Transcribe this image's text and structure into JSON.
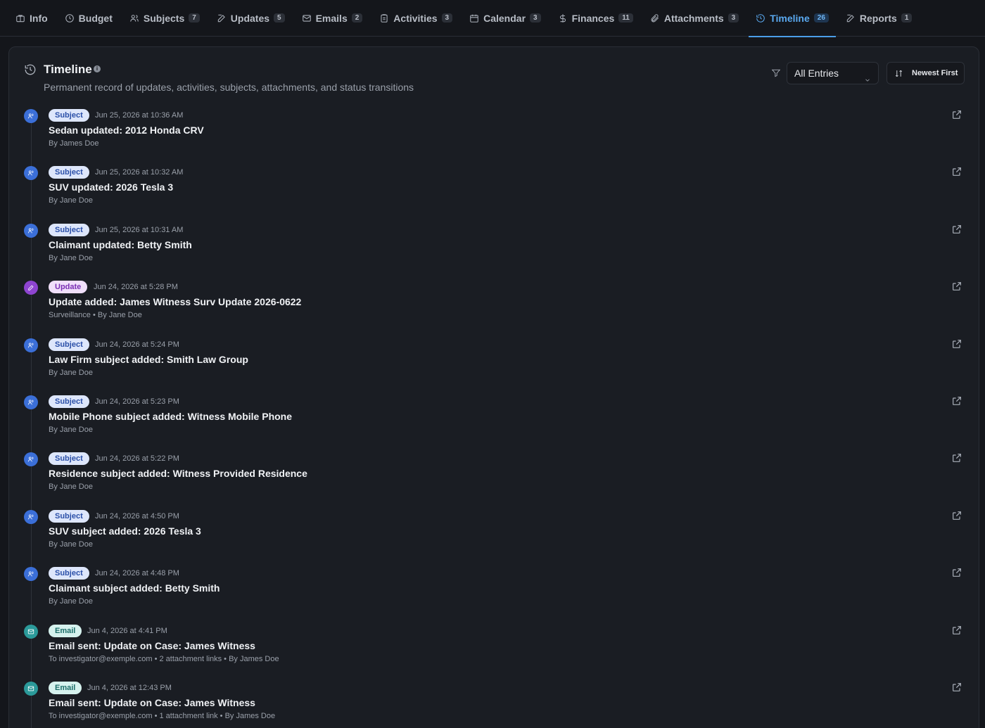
{
  "tabs": [
    {
      "label": "Info",
      "icon": "briefcase-icon",
      "count": ""
    },
    {
      "label": "Budget",
      "icon": "clock-icon",
      "count": ""
    },
    {
      "label": "Subjects",
      "icon": "users-icon",
      "count": "7"
    },
    {
      "label": "Updates",
      "icon": "edit-icon",
      "count": "5"
    },
    {
      "label": "Emails",
      "icon": "mail-icon",
      "count": "2"
    },
    {
      "label": "Activities",
      "icon": "clipboard-icon",
      "count": "3"
    },
    {
      "label": "Calendar",
      "icon": "calendar-icon",
      "count": "3"
    },
    {
      "label": "Finances",
      "icon": "dollar-icon",
      "count": "11"
    },
    {
      "label": "Attachments",
      "icon": "paperclip-icon",
      "count": "3"
    },
    {
      "label": "Timeline",
      "icon": "history-icon",
      "count": "26",
      "active": true
    },
    {
      "label": "Reports",
      "icon": "edit-icon",
      "count": "1"
    }
  ],
  "header": {
    "title": "Timeline",
    "info_glyph": "i",
    "subtitle": "Permanent record of updates, activities, subjects, attachments, and status transitions",
    "filter_value": "All Entries",
    "sort_label": "Newest First"
  },
  "colors": {
    "accent": "#4b9de8",
    "subject": "#3b6fd8",
    "update": "#8e44d0",
    "email": "#2b9a9a"
  },
  "entries": [
    {
      "type": "subject",
      "badge": "Subject",
      "timestamp": "Jun 25, 2026 at 10:36 AM",
      "title": "Sedan updated: 2012 Honda CRV",
      "meta": "By James Doe"
    },
    {
      "type": "subject",
      "badge": "Subject",
      "timestamp": "Jun 25, 2026 at 10:32 AM",
      "title": "SUV updated: 2026 Tesla 3",
      "meta": "By Jane Doe"
    },
    {
      "type": "subject",
      "badge": "Subject",
      "timestamp": "Jun 25, 2026 at 10:31 AM",
      "title": "Claimant updated: Betty Smith",
      "meta": "By Jane Doe"
    },
    {
      "type": "update",
      "badge": "Update",
      "timestamp": "Jun 24, 2026 at 5:28 PM",
      "title": "Update added: James Witness Surv Update 2026-0622",
      "meta": "Surveillance • By Jane Doe"
    },
    {
      "type": "subject",
      "badge": "Subject",
      "timestamp": "Jun 24, 2026 at 5:24 PM",
      "title": "Law Firm subject added: Smith Law Group",
      "meta": "By Jane Doe"
    },
    {
      "type": "subject",
      "badge": "Subject",
      "timestamp": "Jun 24, 2026 at 5:23 PM",
      "title": "Mobile Phone subject added: Witness Mobile Phone",
      "meta": "By Jane Doe"
    },
    {
      "type": "subject",
      "badge": "Subject",
      "timestamp": "Jun 24, 2026 at 5:22 PM",
      "title": "Residence subject added: Witness Provided Residence",
      "meta": "By Jane Doe"
    },
    {
      "type": "subject",
      "badge": "Subject",
      "timestamp": "Jun 24, 2026 at 4:50 PM",
      "title": "SUV subject added: 2026 Tesla 3",
      "meta": "By Jane Doe"
    },
    {
      "type": "subject",
      "badge": "Subject",
      "timestamp": "Jun 24, 2026 at 4:48 PM",
      "title": "Claimant subject added: Betty Smith",
      "meta": "By Jane Doe"
    },
    {
      "type": "email",
      "badge": "Email",
      "timestamp": "Jun 4, 2026 at 4:41 PM",
      "title": "Email sent: Update on Case: James Witness",
      "meta": "To investigator@exemple.com • 2 attachment links • By James Doe"
    },
    {
      "type": "email",
      "badge": "Email",
      "timestamp": "Jun 4, 2026 at 12:43 PM",
      "title": "Email sent: Update on Case: James Witness",
      "meta": "To investigator@exemple.com • 1 attachment link • By James Doe"
    }
  ]
}
